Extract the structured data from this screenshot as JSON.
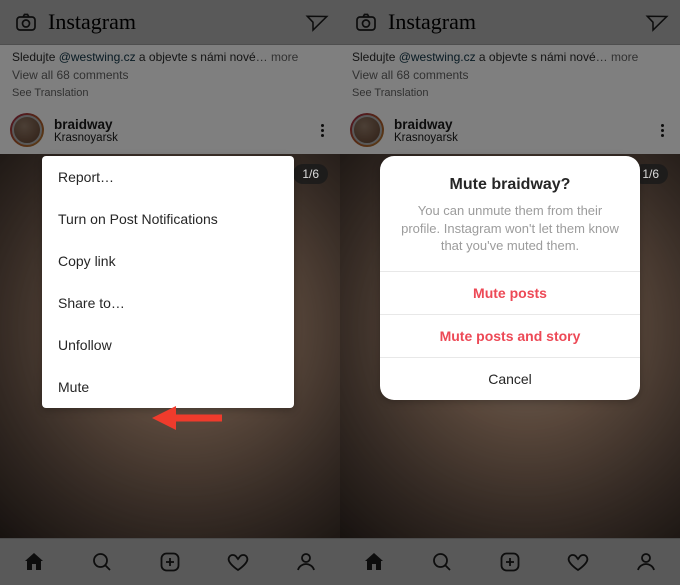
{
  "logo_text": "Instagram",
  "caption_prefix": "Sledujte ",
  "caption_mention": "@westwing.cz",
  "caption_suffix": " a objevte s námi nové",
  "more_label": "more",
  "view_all": "View all 68 comments",
  "see_translation": "See Translation",
  "post": {
    "username": "braidway",
    "location": "Krasnoyarsk"
  },
  "counter": "1/6",
  "menu": {
    "report": "Report…",
    "notifications": "Turn on Post Notifications",
    "copy": "Copy link",
    "share": "Share to…",
    "unfollow": "Unfollow",
    "mute": "Mute"
  },
  "dialog": {
    "title": "Mute braidway?",
    "body": "You can unmute them from their profile. Instagram won't let them know that you've muted them.",
    "mute_posts": "Mute posts",
    "mute_posts_story": "Mute posts and story",
    "cancel": "Cancel"
  }
}
